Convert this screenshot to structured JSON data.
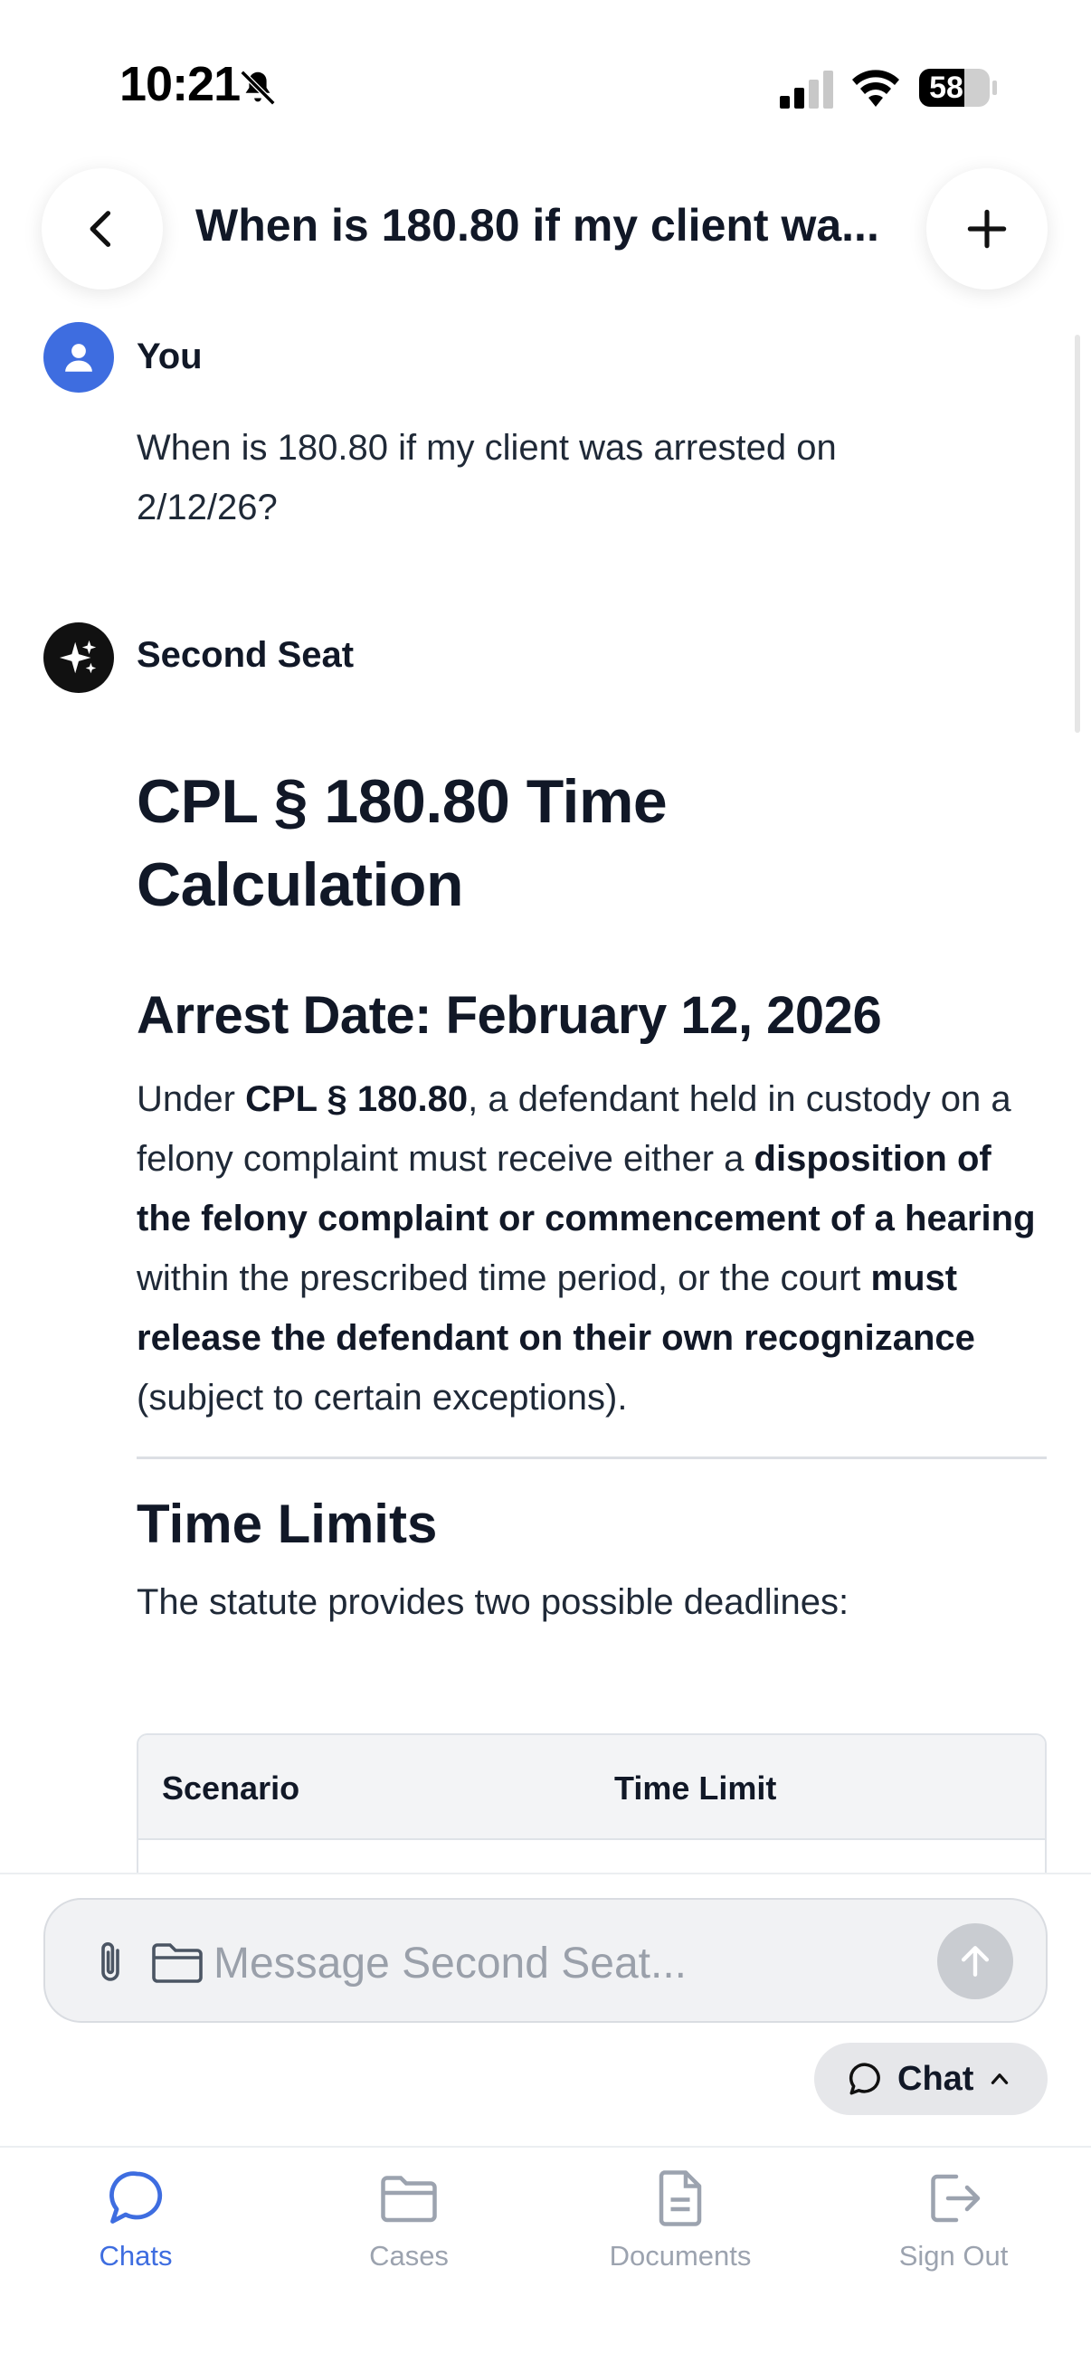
{
  "status_bar": {
    "time": "10:21",
    "battery": "58",
    "icons": [
      "bell-slash-icon",
      "signal-icon",
      "wifi-icon",
      "battery-icon"
    ]
  },
  "header": {
    "title": "When is 180.80 if my client wa...",
    "back_icon": "chevron-left-icon",
    "new_icon": "plus-icon"
  },
  "messages": {
    "user": {
      "sender": "You",
      "text": "When is 180.80 if my client was arrested on 2/12/26?"
    },
    "assistant": {
      "sender": "Second Seat",
      "heading": "CPL § 180.80 Time Calculation",
      "subheading": "Arrest Date: February 12, 2026",
      "paragraph": {
        "t1": "Under ",
        "b1": "CPL § 180.80",
        "t2": ", a defendant held in custody on a felony complaint must receive either a ",
        "b2": "disposition of the felony complaint or commencement of a hearing",
        "t3": " within the prescribed time period, or the court ",
        "b3": "must release the defendant on their own recognizance",
        "t4": " (subject to certain exceptions)."
      },
      "section_title": "Time Limits",
      "section_text": "The statute provides two possible deadlines:",
      "table": {
        "headers": [
          "Scenario",
          "Time Limit"
        ]
      }
    }
  },
  "composer": {
    "placeholder": "Message Second Seat...",
    "mode_label": "Chat"
  },
  "tabs": [
    {
      "label": "Chats",
      "icon": "chat-bubble-icon",
      "active": true
    },
    {
      "label": "Cases",
      "icon": "folder-icon",
      "active": false
    },
    {
      "label": "Documents",
      "icon": "document-icon",
      "active": false
    },
    {
      "label": "Sign Out",
      "icon": "sign-out-icon",
      "active": false
    }
  ],
  "colors": {
    "accent": "#3e6de0",
    "text": "#111827",
    "muted": "#9ca3af"
  }
}
